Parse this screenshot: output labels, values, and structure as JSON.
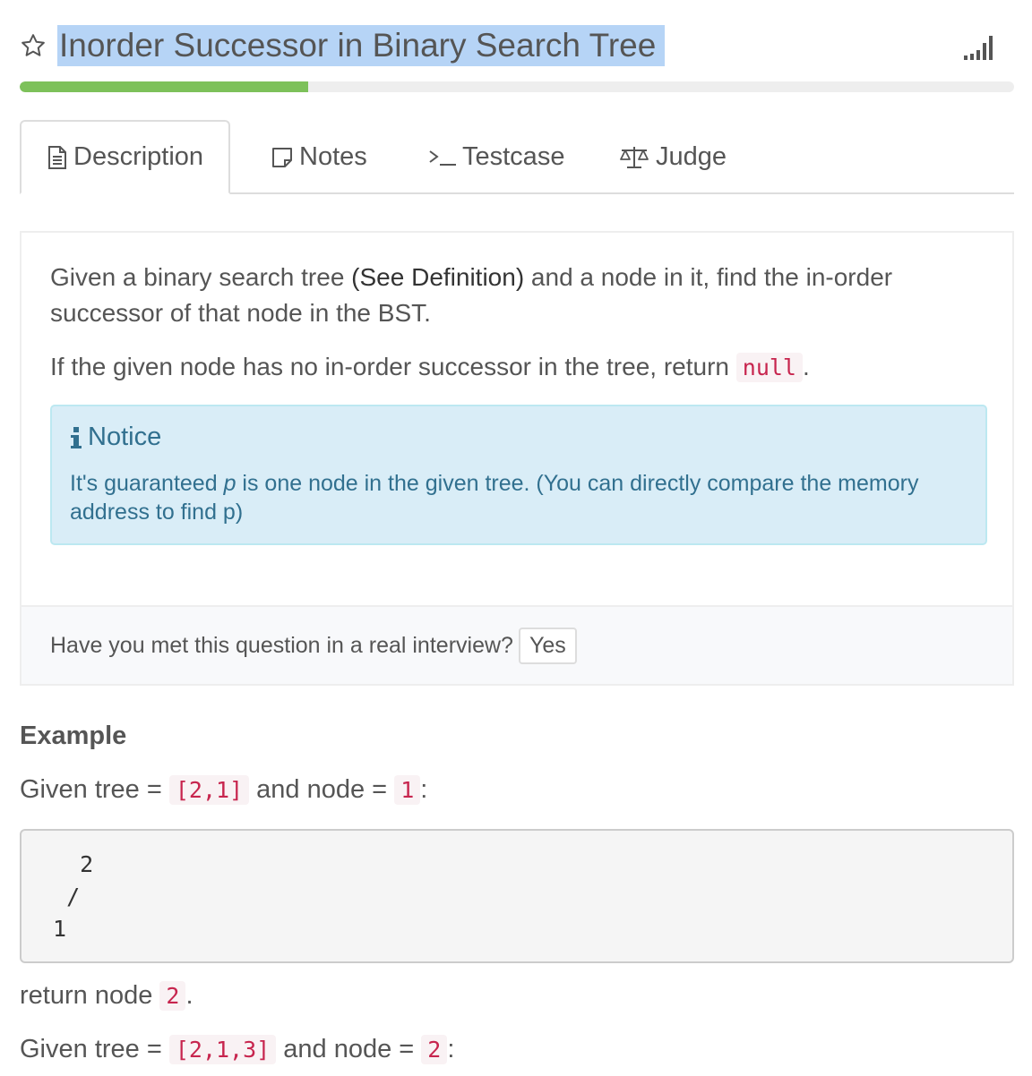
{
  "header": {
    "title": "Inorder Successor in Binary Search Tree",
    "icons": [
      "star-icon",
      "signal-bars-icon"
    ]
  },
  "progress": {
    "fraction": 0.29,
    "color": "#7dc15a"
  },
  "tabs": [
    {
      "label": "Description",
      "icon": "document-icon",
      "active": true
    },
    {
      "label": "Notes",
      "icon": "note-icon",
      "active": false
    },
    {
      "label": "Testcase",
      "icon": "terminal-icon",
      "active": false
    },
    {
      "label": "Judge",
      "icon": "scale-icon",
      "active": false
    }
  ],
  "description": {
    "p1_before": "Given a binary search tree ",
    "p1_link": "(See Definition)",
    "p1_after": " and a node in it, find the in-order successor of that node in the BST.",
    "p2_before": "If the given node has no in-order successor in the tree, return ",
    "p2_code": "null",
    "p2_after": "."
  },
  "notice": {
    "icon": "info-icon",
    "title": "Notice",
    "text_before": "It's guaranteed ",
    "text_em": "p",
    "text_after": " is one node in the given tree. (You can directly compare the memory address to find p)"
  },
  "footer": {
    "question": "Have you met this question in a real interview?",
    "yes_label": "Yes"
  },
  "example": {
    "heading": "Example",
    "given1_prefix": "Given tree = ",
    "given1_tree": "[2,1]",
    "given1_mid": " and node = ",
    "given1_node": "1",
    "given1_suffix": ":",
    "tree_diagram": "   2\n  /\n 1",
    "return_prefix": "return node ",
    "return_node": "2",
    "return_suffix": ".",
    "given2_prefix": "Given tree = ",
    "given2_tree": "[2,1,3]",
    "given2_mid": " and node = ",
    "given2_node": "2",
    "given2_suffix": ":"
  },
  "colors": {
    "title_highlight": "#b6d4f6",
    "code_text": "#c7254e",
    "notice_bg": "#d9edf7",
    "notice_text": "#31708f"
  }
}
